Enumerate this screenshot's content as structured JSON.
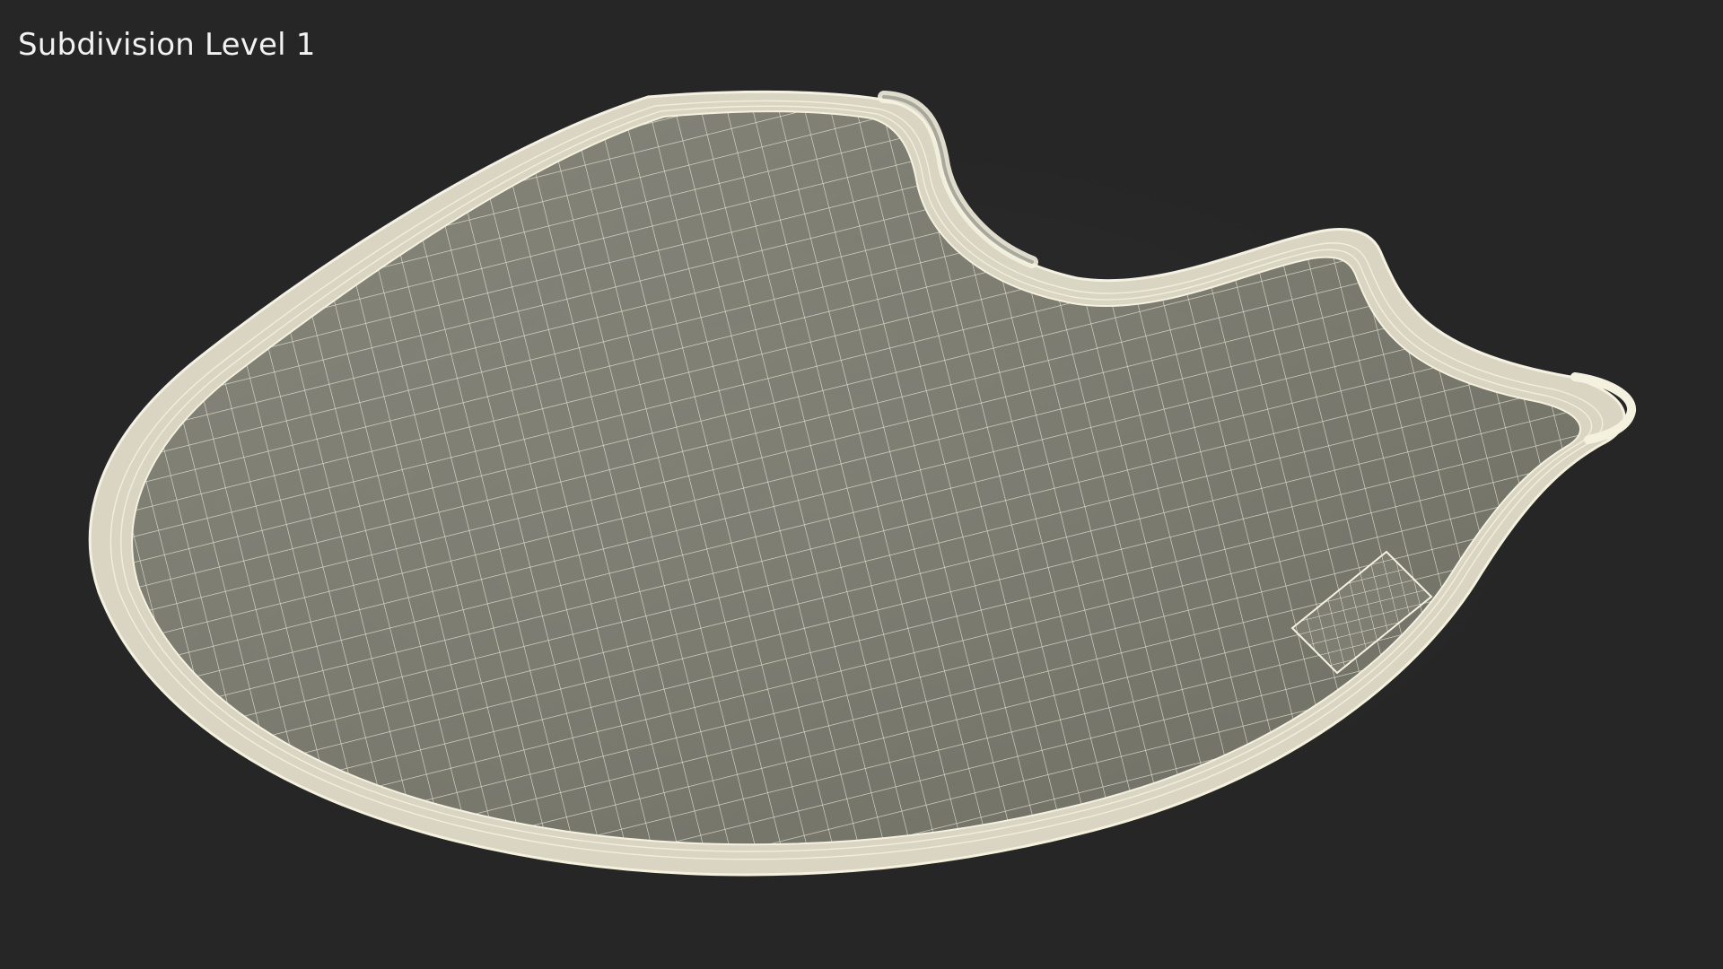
{
  "viewport": {
    "label": "Subdivision Level 1",
    "background_color": "#262626",
    "label_color": "#f2f2f2"
  },
  "model": {
    "shading": "wireframe-on-shaded",
    "surface_color": "#7a7a6f",
    "wire_color": "#f4f1df",
    "rim_color": "#d9d5c2"
  }
}
